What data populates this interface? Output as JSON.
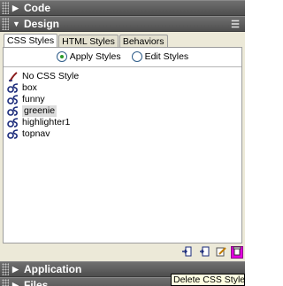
{
  "panels": {
    "code": {
      "title": "Code",
      "arrow": "▶"
    },
    "design": {
      "title": "Design",
      "arrow": "▼",
      "options_glyph": "☰"
    },
    "application": {
      "title": "Application",
      "arrow": "▶"
    },
    "files": {
      "title": "Files",
      "arrow": "▶"
    }
  },
  "tabs": [
    {
      "label": "CSS Styles",
      "active": true
    },
    {
      "label": "HTML Styles",
      "active": false
    },
    {
      "label": "Behaviors",
      "active": false
    }
  ],
  "radio": {
    "apply_label": "Apply Styles",
    "edit_label": "Edit Styles",
    "selected": "apply"
  },
  "styles": [
    {
      "label": "No CSS Style",
      "icon": "no-style-icon",
      "selected": false
    },
    {
      "label": "box",
      "icon": "css-style-icon",
      "selected": false
    },
    {
      "label": "funny",
      "icon": "css-style-icon",
      "selected": false
    },
    {
      "label": "greenie",
      "icon": "css-style-icon",
      "selected": true
    },
    {
      "label": "highlighter1",
      "icon": "css-style-icon",
      "selected": false
    },
    {
      "label": "topnav",
      "icon": "css-style-icon",
      "selected": false
    }
  ],
  "toolbar": {
    "buttons": [
      "attach-stylesheet-icon",
      "new-style-icon",
      "edit-style-icon",
      "delete-style-icon"
    ],
    "hot_button": "delete-style-icon"
  },
  "tooltip": {
    "text": "Delete CSS Style"
  },
  "colors": {
    "panel_header": "#5a5a5a",
    "panel_body": "#ece9d8",
    "radio_dot": "#2a9b2a",
    "hot_button": "#e400e0",
    "tooltip_bg": "#ffffe1"
  }
}
